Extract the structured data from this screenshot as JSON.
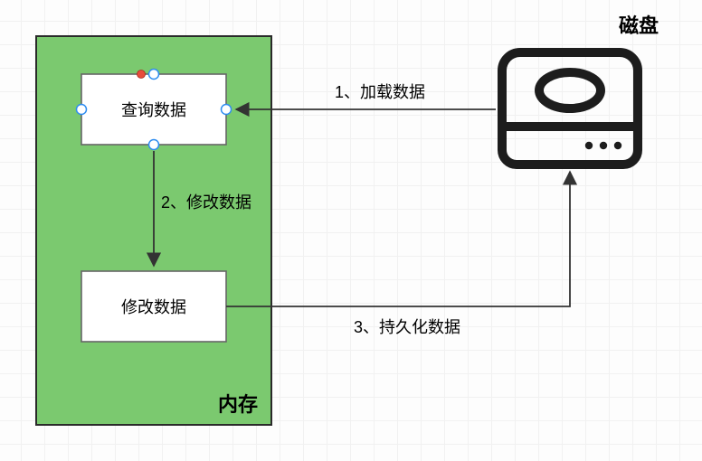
{
  "memory": {
    "label": "内存",
    "nodes": {
      "query": "查询数据",
      "modify": "修改数据"
    }
  },
  "disk": {
    "label": "磁盘"
  },
  "arrows": {
    "load": {
      "label": "1、加载数据"
    },
    "modify": {
      "label": "2、修改数据"
    },
    "persist": {
      "label": "3、持久化数据"
    }
  },
  "editing_node": "query"
}
